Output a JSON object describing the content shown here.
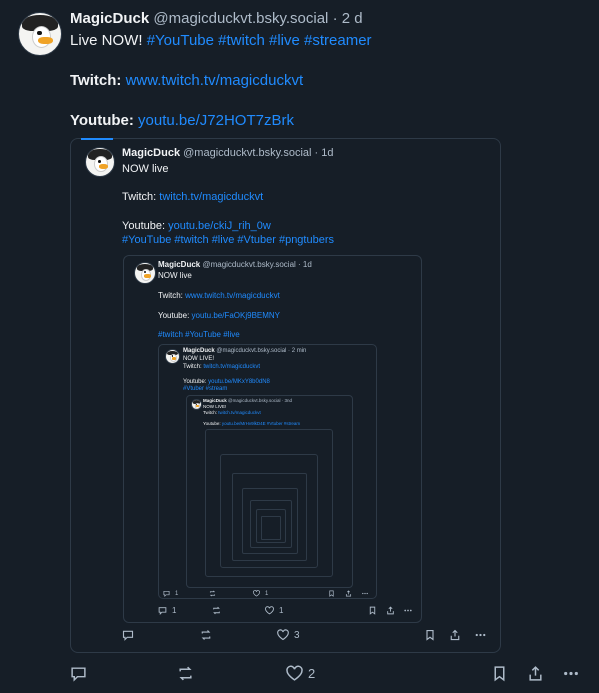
{
  "post": {
    "author_name": "MagicDuck",
    "author_handle": "@magicduckvt.bsky.social",
    "time": "· 2 d",
    "line1_prefix": "Live NOW! ",
    "line1_tags": "#YouTube #twitch #live #streamer",
    "twitch_label": "Twitch:",
    "twitch_link": "www.twitch.tv/magicduckvt",
    "youtube_label": "Youtube:",
    "youtube_link": "youtu.be/J72HOT7zBrk",
    "like_count": "2"
  },
  "quote1": {
    "author_name": "MagicDuck",
    "author_handle": "@magicduckvt.bsky.social · 1d",
    "text": "NOW live",
    "twitch_label": "Twitch:",
    "twitch_link": "twitch.tv/magicduckvt",
    "youtube_label": "Youtube:",
    "youtube_link": "youtu.be/ckiJ_rih_0w",
    "tags": "#YouTube #twitch #live #Vtuber #pngtubers",
    "like_count": "3"
  },
  "quote2": {
    "author_name": "MagicDuck",
    "author_handle": "@magicduckvt.bsky.social · 1d",
    "text": "NOW live",
    "twitch_label": "Twitch:",
    "twitch_link": "www.twitch.tv/magicduckvt",
    "youtube_label": "Youtube:",
    "youtube_link": "youtu.be/FaOKj9BEMNY",
    "tags": "#twitch #YouTube #live",
    "reply_count": "1",
    "like_count": "1"
  },
  "quote3": {
    "author_name": "MagicDuck",
    "author_handle": "@magicduckvt.bsky.social · 2 min",
    "text": "NOW LIVE!",
    "twitch_label": "Twitch:",
    "twitch_link": "twitch.tv/magicduckvt",
    "youtube_label": "Youtube:",
    "youtube_link": "youtu.be/MKxY8b0dN8",
    "tags": "#Vtuber #stream",
    "reply_count": "1",
    "like_count": "1"
  },
  "quote4": {
    "author_name": "MagicDuck",
    "author_handle": "@magicduckvt.bsky.social · 3nd",
    "text": "NOW LIVE!",
    "twitch_label": "Twitch:",
    "twitch_link": "twitch.tv/magicduckvt",
    "youtube_label": "Youtube:",
    "youtube_link": "youtu.be/MrHv9lkD4E #Vtuber #stream"
  },
  "colors": {
    "background": "#161e27",
    "link": "#208bfe",
    "muted": "#aebbc9",
    "border": "#2e3a47"
  }
}
